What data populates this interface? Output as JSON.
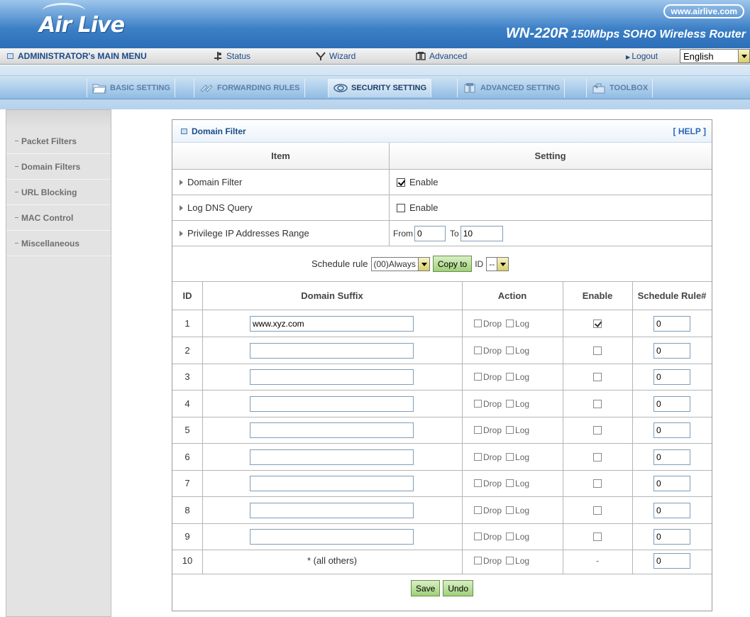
{
  "header": {
    "logo": "Air Live",
    "url": "www.airlive.com",
    "model": "WN-220R",
    "model_desc": "150Mbps SOHO Wireless Router"
  },
  "menubar": {
    "admin": "ADMINISTRATOR's MAIN MENU",
    "status": "Status",
    "wizard": "Wizard",
    "advanced": "Advanced",
    "logout": "Logout",
    "language": "English"
  },
  "tabs": [
    {
      "label": "BASIC SETTING",
      "icon": "folder-icon"
    },
    {
      "label": "FORWARDING RULES",
      "icon": "arrows-icon"
    },
    {
      "label": "SECURITY SETTING",
      "icon": "eye-icon"
    },
    {
      "label": "ADVANCED SETTING",
      "icon": "advanced-icon"
    },
    {
      "label": "TOOLBOX",
      "icon": "toolbox-icon"
    }
  ],
  "sidebar": {
    "items": [
      "Packet Filters",
      "Domain Filters",
      "URL Blocking",
      "MAC Control",
      "Miscellaneous"
    ]
  },
  "panel": {
    "title": "Domain Filter",
    "help": "[ HELP ]",
    "item_header": "Item",
    "setting_header": "Setting",
    "domain_filter_label": "Domain Filter",
    "domain_filter_enable": "Enable",
    "log_dns_label": "Log DNS Query",
    "log_dns_enable": "Enable",
    "privilege_label": "Privilege IP Addresses Range",
    "from_label": "From",
    "from_value": "0",
    "to_label": "To",
    "to_value": "10",
    "schedule_label": "Schedule rule",
    "schedule_value": "(00)Always",
    "copy_to": "Copy to",
    "id_label": "ID",
    "id_value": "--"
  },
  "table": {
    "headers": {
      "id": "ID",
      "suffix": "Domain Suffix",
      "action": "Action",
      "enable": "Enable",
      "rule": "Schedule Rule#"
    },
    "drop_label": "Drop",
    "log_label": "Log",
    "rows": [
      {
        "id": "1",
        "suffix": "www.xyz.com",
        "enabled": true,
        "rule": "0"
      },
      {
        "id": "2",
        "suffix": "",
        "enabled": false,
        "rule": "0"
      },
      {
        "id": "3",
        "suffix": "",
        "enabled": false,
        "rule": "0"
      },
      {
        "id": "4",
        "suffix": "",
        "enabled": false,
        "rule": "0"
      },
      {
        "id": "5",
        "suffix": "",
        "enabled": false,
        "rule": "0"
      },
      {
        "id": "6",
        "suffix": "",
        "enabled": false,
        "rule": "0"
      },
      {
        "id": "7",
        "suffix": "",
        "enabled": false,
        "rule": "0"
      },
      {
        "id": "8",
        "suffix": "",
        "enabled": false,
        "rule": "0"
      },
      {
        "id": "9",
        "suffix": "",
        "enabled": false,
        "rule": "0"
      }
    ],
    "last_row": {
      "id": "10",
      "suffix": "* (all others)",
      "enable": "-",
      "rule": "0"
    }
  },
  "buttons": {
    "save": "Save",
    "undo": "Undo"
  }
}
